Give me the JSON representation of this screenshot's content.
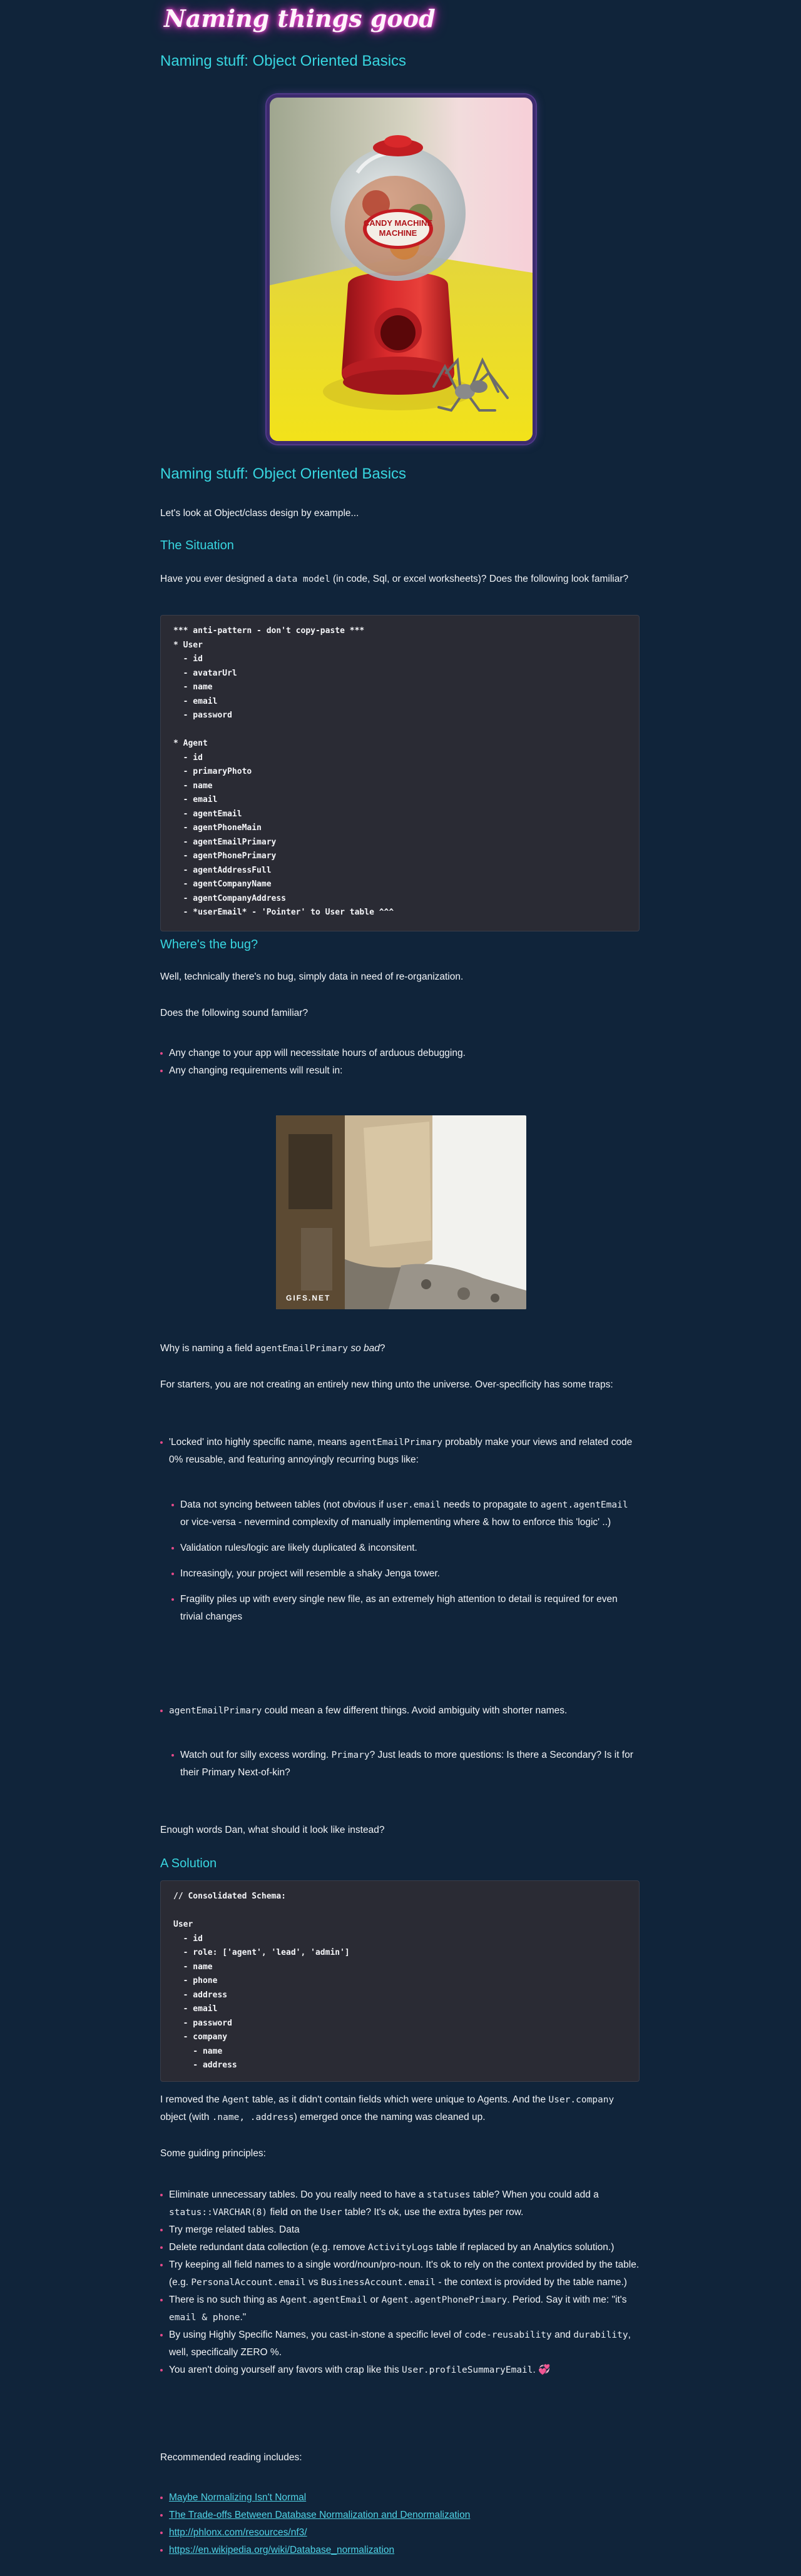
{
  "site": {
    "title": "Naming things good"
  },
  "article": {
    "heading": "Naming stuff: Object Oriented Basics",
    "title": "Naming stuff: Object Oriented Basics",
    "hero_image": {
      "alt": "Red candy machine gumball dispenser with a metal spider next to it",
      "label": "CANDY MACHINE"
    },
    "intro": "Let's look at Object/class design by example...",
    "situation": {
      "heading": "The Situation",
      "text_before": "Have you ever designed a ",
      "code": "data model",
      "text_after": " (in code, Sql, or excel worksheets)? Does the following look familiar?"
    },
    "code_antipattern": "*** anti-pattern - don't copy-paste ***\n* User\n  - id\n  - avatarUrl\n  - name\n  - email\n  - password\n\n* Agent\n  - id\n  - primaryPhoto\n  - name\n  - email\n  - agentEmail\n  - agentPhoneMain\n  - agentEmailPrimary\n  - agentPhonePrimary\n  - agentAddressFull\n  - agentCompanyName\n  - agentCompanyAddress\n  - *userEmail* - 'Pointer' to User table ^^^",
    "bug": {
      "heading": "Where's the bug?",
      "p1": "Well, technically there's no bug, simply data in need of re-organization.",
      "p2": "Does the following sound familiar?",
      "items": [
        "Any change to your app will necessitate hours of arduous debugging.",
        "Any changing requirements will result in:"
      ],
      "gif_watermark": "GIFS.NET"
    },
    "why": {
      "before": "Why is naming a field ",
      "code": "agentEmailPrimary",
      "em": "so bad",
      "after": "?"
    },
    "starters": "For starters, you are not creating an entirely new thing unto the universe. Over-specificity has some traps:",
    "locked": {
      "before": "'Locked' into highly specific name, means ",
      "code": "agentEmailPrimary",
      "after": " probably make your views and related code 0% reusable, and featuring annoyingly recurring bugs like:"
    },
    "sync": {
      "a": "Data not syncing between tables (not obvious if ",
      "code1": "user.email",
      "b": " needs to propagate to ",
      "code2": "agent.agentEmail",
      "c": " or vice-versa - nevermind complexity of manually implementing where & how to enforce this 'logic' ..)"
    },
    "sub_items": [
      "Validation rules/logic are likely duplicated & inconsitent.",
      "Increasingly, your project will resemble a shaky Jenga tower.",
      "Fragility piles up with every single new file, as an extremely high attention to detail is required for even trivial changes"
    ],
    "meanings": {
      "code": "agentEmailPrimary",
      "after": " could mean a few different things. Avoid ambiguity with shorter names."
    },
    "watch": {
      "before": "Watch out for silly excess wording. ",
      "code": "Primary",
      "after": "? Just leads to more questions: Is there a Secondary? Is it for their Primary Next-of-kin?"
    },
    "enough": "Enough words Dan, what should it look like instead?",
    "solution": {
      "heading": "A Solution",
      "code": "// Consolidated Schema:\n\nUser\n  - id\n  - role: ['agent', 'lead', 'admin']\n  - name\n  - phone\n  - address\n  - email\n  - password\n  - company\n    - name\n    - address"
    },
    "removed": {
      "a": "I removed the ",
      "code1": "Agent",
      "b": " table, as it didn't contain fields which were unique to Agents. And the ",
      "code2": "User.company",
      "c": " object (with ",
      "code3": ".name, .address",
      "d": ") emerged once the naming was cleaned up."
    },
    "principles_intro": "Some guiding principles:",
    "principles": {
      "p1": {
        "a": "Eliminate unnecessary tables. Do you really need to have a ",
        "code1": "statuses",
        "b": " table? When you could add a ",
        "code2": "status::VARCHAR(8)",
        "c": " field on the ",
        "code3": "User",
        "d": " table? It's ok, use the extra bytes per row."
      },
      "p2": "Try merge related tables. Data",
      "p3": {
        "a": "Delete redundant data collection (e.g. remove ",
        "code": "ActivityLogs",
        "b": " table if replaced by an Analytics solution.)"
      },
      "p4": {
        "a": "Try keeping all field names to a single word/noun/pro-noun. It's ok to rely on the context provided by the table. (e.g. ",
        "code1": "PersonalAccount.email",
        "b": " vs ",
        "code2": "BusinessAccount.email",
        "c": " - the context is provided by the table name.)"
      },
      "p5": {
        "a": "There is no such thing as ",
        "code1": "Agent.agentEmail",
        "b": " or ",
        "code2": "Agent.agentPhonePrimary",
        "c": ". Period. Say it with me: \"it's ",
        "code3": "email & phone",
        "d": ".\""
      },
      "p6": {
        "a": "By using Highly Specific Names, you cast-in-stone a specific level of ",
        "code1": "code-reusability",
        "b": " and ",
        "code2": "durability",
        "c": ", well, specifically ZERO %."
      },
      "p7": {
        "a": "You aren't doing yourself any favors with crap like this ",
        "code": "User.profileSummaryEmail",
        "b": ". ",
        "emoji": "💞"
      }
    },
    "reading_intro": "Recommended reading includes:",
    "links": [
      "Maybe Normalizing Isn't Normal",
      "The Trade-offs Between Database Normalization and Denormalization",
      "http://phlonx.com/resources/nf3/",
      "https://en.wikipedia.org/wiki/Database_normalization"
    ],
    "colors": {
      "background": "#10243a",
      "accent": "#38d6e0",
      "bullet": "#e64a8a",
      "neon": "#ff4fd8",
      "code_bg": "#2a2b34"
    }
  }
}
